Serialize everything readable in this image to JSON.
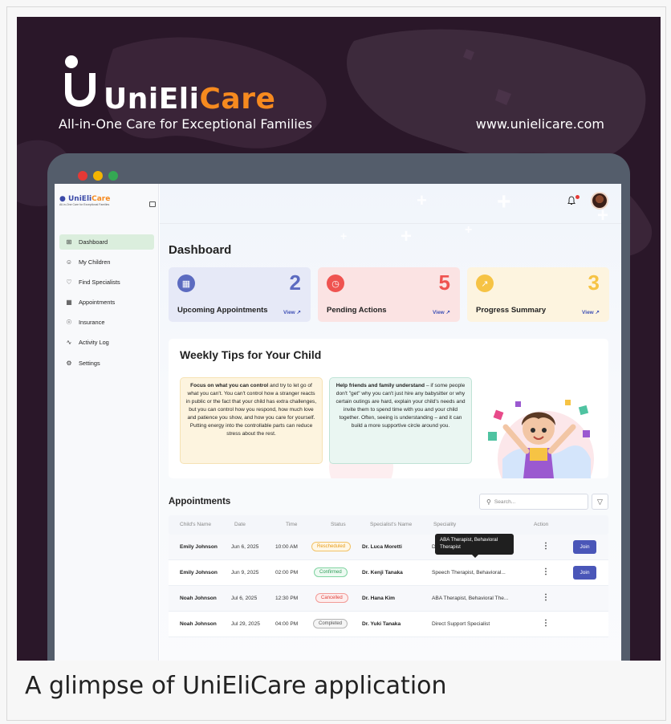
{
  "hero": {
    "brand_prefix": "UniEli",
    "brand_suffix": "Care",
    "tagline": "All-in-One Care for Exceptional Families",
    "website": "www.unielicare.com"
  },
  "window": {
    "control_colors": [
      "#e53935",
      "#f4b400",
      "#34a853"
    ]
  },
  "sidebar": {
    "brand_prefix": "UniEli",
    "brand_suffix": "Care",
    "brand_tagline": "All-in-One Care for Exceptional Families",
    "items": [
      {
        "label": "Dashboard",
        "icon": "grid-icon",
        "active": true
      },
      {
        "label": "My Children",
        "icon": "person-icon"
      },
      {
        "label": "Find Specialists",
        "icon": "heart-hand-icon"
      },
      {
        "label": "Appointments",
        "icon": "calendar-icon"
      },
      {
        "label": "Insurance",
        "icon": "shield-icon"
      },
      {
        "label": "Activity Log",
        "icon": "activity-icon"
      },
      {
        "label": "Settings",
        "icon": "gear-icon"
      }
    ]
  },
  "main": {
    "title": "Dashboard",
    "cards": [
      {
        "label": "Upcoming Appointments",
        "value": "2",
        "link": "View ↗",
        "color": "#5c6bc0",
        "bg": "#e6e9f7"
      },
      {
        "label": "Pending Actions",
        "value": "5",
        "link": "View ↗",
        "color": "#ef5350",
        "bg": "#fbe3e3"
      },
      {
        "label": "Progress Summary",
        "value": "3",
        "link": "View ↗",
        "color": "#f6c344",
        "bg": "#fdf4df"
      }
    ]
  },
  "tips": {
    "title": "Weekly Tips for Your Child",
    "tip1_bold": "Focus on what you can control",
    "tip1_text": " and try to let go of what you can't. You can't control how a stranger reacts in public or the fact that your child has extra challenges, but you can control how you respond, how much love and patience you show, and how you care for yourself. Putting energy into the controllable parts can reduce stress about the rest.",
    "tip2_bold": "Help friends and family understand",
    "tip2_text": " – if some people don't \"get\" why you can't just hire any babysitter or why certain outings are hard, explain your child's needs and invite them to spend time with you and your child together. Often, seeing is understanding – and it can build a more supportive circle around you."
  },
  "appointments": {
    "title": "Appointments",
    "search_placeholder": "Search...",
    "headers": [
      "Child's Name",
      "Date",
      "Time",
      "Status",
      "Specialist's Name",
      "Speciality",
      "Action"
    ],
    "rows": [
      {
        "child": "Emily Johnson",
        "date": "Jun 6, 2025",
        "time": "10:00 AM",
        "status": "Rescheduled",
        "specialist": "Dr. Luca Moretti",
        "speciality": "Devel",
        "join": "Join"
      },
      {
        "child": "Emily Johnson",
        "date": "Jun 9, 2025",
        "time": "02:00 PM",
        "status": "Confirmed",
        "specialist": "Dr. Kenji Tanaka",
        "speciality": "Speech Therapist, Behavioral...",
        "join": "Join"
      },
      {
        "child": "Noah Johnson",
        "date": "Jul 6, 2025",
        "time": "12:30 PM",
        "status": "Cancelled",
        "specialist": "Dr. Hana Kim",
        "speciality": "ABA Therapist, Behavioral The..."
      },
      {
        "child": "Noah Johnson",
        "date": "Jul 29, 2025",
        "time": "04:00 PM",
        "status": "Completed",
        "specialist": "Dr. Yuki Tanaka",
        "speciality": "Direct Support Specialist"
      }
    ],
    "tooltip": "ABA Therapist, Behavioral Therapist"
  },
  "caption": "A glimpse of UniEliCare application"
}
